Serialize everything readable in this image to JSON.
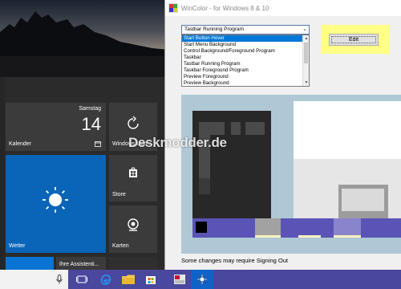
{
  "window": {
    "title": "WinColor - for Windows 8 & 10",
    "dropdown_value": "Tastbar Running Program",
    "list_items": [
      "Start Button Hover",
      "Start Menu Background",
      "Control Background/Foreground Program",
      "Taskbar",
      "Tastbar Running Program",
      "Taskbar Foreground Program",
      "Preview Foreground",
      "Preview Background"
    ],
    "edit_label": "Edit",
    "status": "Some changes may require Signing Out"
  },
  "start_menu": {
    "calendar": {
      "day": "Samstag",
      "date": "14",
      "label": "Kalender"
    },
    "update": {
      "label": "Windows Upd..."
    },
    "weather": {
      "label": "Wetter"
    },
    "store": {
      "label": "Store"
    },
    "camera": {
      "label": "Karten"
    },
    "assist": {
      "label": "Ihre Assistenti..."
    }
  },
  "watermark": "Deskmodder.de",
  "colors": {
    "accent_yellow": "#ffff88",
    "selection": "#0078d7",
    "taskbar": "#4a479e",
    "preview_taskbar": "#5a54b6",
    "weather_tile": "#0a64b8"
  }
}
